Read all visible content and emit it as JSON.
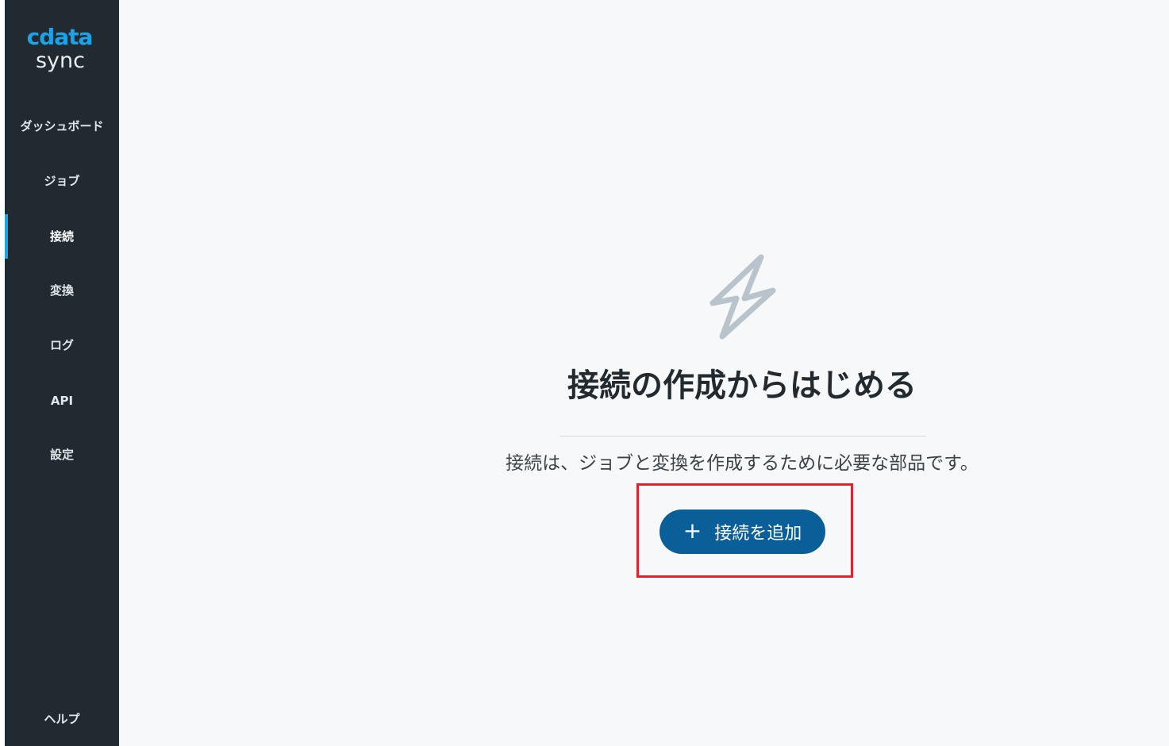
{
  "logo": {
    "brand": "cdata",
    "product": "sync"
  },
  "sidebar": {
    "items": [
      {
        "label": "ダッシュボード"
      },
      {
        "label": "ジョブ"
      },
      {
        "label": "接続",
        "active": true
      },
      {
        "label": "変換"
      },
      {
        "label": "ログ"
      },
      {
        "label": "API"
      },
      {
        "label": "設定"
      }
    ],
    "help_label": "ヘルプ"
  },
  "main": {
    "icon": "lightning-bolt-icon",
    "heading": "接続の作成からはじめる",
    "description": "接続は、ジョブと変換を作成するために必要な部品です。",
    "add_button_label": "接続を追加",
    "add_button_icon": "plus-icon"
  },
  "colors": {
    "sidebar_bg": "#212a30",
    "accent": "#1aa3e8",
    "button": "#0a5f99",
    "highlight": "#e3212d",
    "icon": "#b8c3cb"
  }
}
